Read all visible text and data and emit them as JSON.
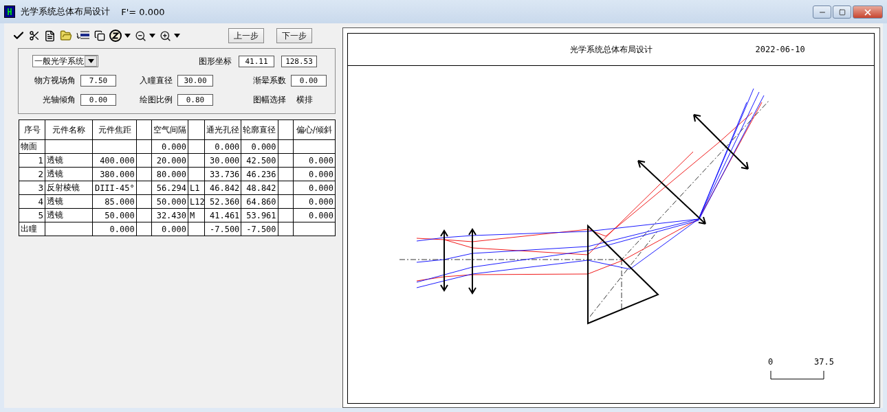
{
  "window": {
    "title": "光学系统总体布局设计",
    "focal_readout": "F'= 0.000"
  },
  "toolbar": {
    "tools": [
      {
        "kind": "check",
        "has_menu": false
      },
      {
        "kind": "cut",
        "has_menu": false
      },
      {
        "kind": "document",
        "has_menu": false
      },
      {
        "kind": "open",
        "has_menu": false
      },
      {
        "kind": "insert",
        "has_menu": false
      },
      {
        "kind": "copy",
        "has_menu": false
      },
      {
        "kind": "zcircle",
        "has_menu": true
      },
      {
        "kind": "zoomout",
        "has_menu": true
      },
      {
        "kind": "zoomin",
        "has_menu": true
      }
    ],
    "step_buttons": [
      "上一步",
      "下一步"
    ]
  },
  "settings": {
    "system_type": "一般光学系统",
    "coords": {
      "label": "图形坐标",
      "values": [
        "41.11",
        "128.53"
      ]
    },
    "rows": [
      [
        {
          "kind": "field",
          "label": "物方视场角",
          "value": "7.50"
        },
        {
          "kind": "field",
          "label": "入瞳直径",
          "value": "30.00"
        },
        {
          "kind": "field",
          "label": "渐晕系数",
          "value": "0.00"
        }
      ],
      [
        {
          "kind": "field",
          "label": "光轴倾角",
          "value": "0.00"
        },
        {
          "kind": "field",
          "label": "绘图比例",
          "value": "0.80"
        },
        {
          "kind": "text",
          "label": "图幅选择",
          "value": "横排"
        }
      ]
    ]
  },
  "table": {
    "header": {
      "no": "序号",
      "name": "元件名称",
      "focal": "元件焦距",
      "air_gap": "空气间隔",
      "clear_aperture": "通光孔径",
      "outer_diameter": "轮廓直径",
      "tilt": "偏心/倾斜"
    },
    "rows": [
      {
        "kind": "surface",
        "no": "物面",
        "air_gap": "0.000",
        "clear_aperture": "0.000",
        "outer_diameter": "0.000"
      },
      {
        "kind": "element",
        "no": "1",
        "name": "透镜",
        "focal": "400.000",
        "air_gap": "20.000",
        "clear_aperture": "30.000",
        "outer_diameter": "42.500",
        "tilt": "0.000"
      },
      {
        "kind": "element",
        "no": "2",
        "name": "透镜",
        "focal": "380.000",
        "air_gap": "80.000",
        "clear_aperture": "33.736",
        "outer_diameter": "46.236",
        "tilt": "0.000"
      },
      {
        "kind": "element",
        "no": "3",
        "name": "反射棱镜",
        "focal": "DIII-45°",
        "air_gap": "56.294",
        "tag": "L1",
        "clear_aperture": "46.842",
        "outer_diameter": "48.842",
        "tilt": "0.000"
      },
      {
        "kind": "element",
        "no": "4",
        "name": "透镜",
        "focal": "85.000",
        "air_gap": "50.000",
        "tag": "L12",
        "clear_aperture": "52.360",
        "outer_diameter": "64.860",
        "tilt": "0.000"
      },
      {
        "kind": "element",
        "no": "5",
        "name": "透镜",
        "focal": "50.000",
        "air_gap": "32.430",
        "tag": "M",
        "clear_aperture": "41.461",
        "outer_diameter": "53.961",
        "tilt": "0.000"
      },
      {
        "kind": "surface",
        "no": "出瞳",
        "focal": "0.000",
        "air_gap": "0.000",
        "clear_aperture": "-7.500",
        "outer_diameter": "-7.500"
      }
    ]
  },
  "drawing": {
    "title": "光学系统总体布局设计",
    "date": "2022-06-10",
    "scale_start": "0",
    "scale_end": "37.5"
  }
}
